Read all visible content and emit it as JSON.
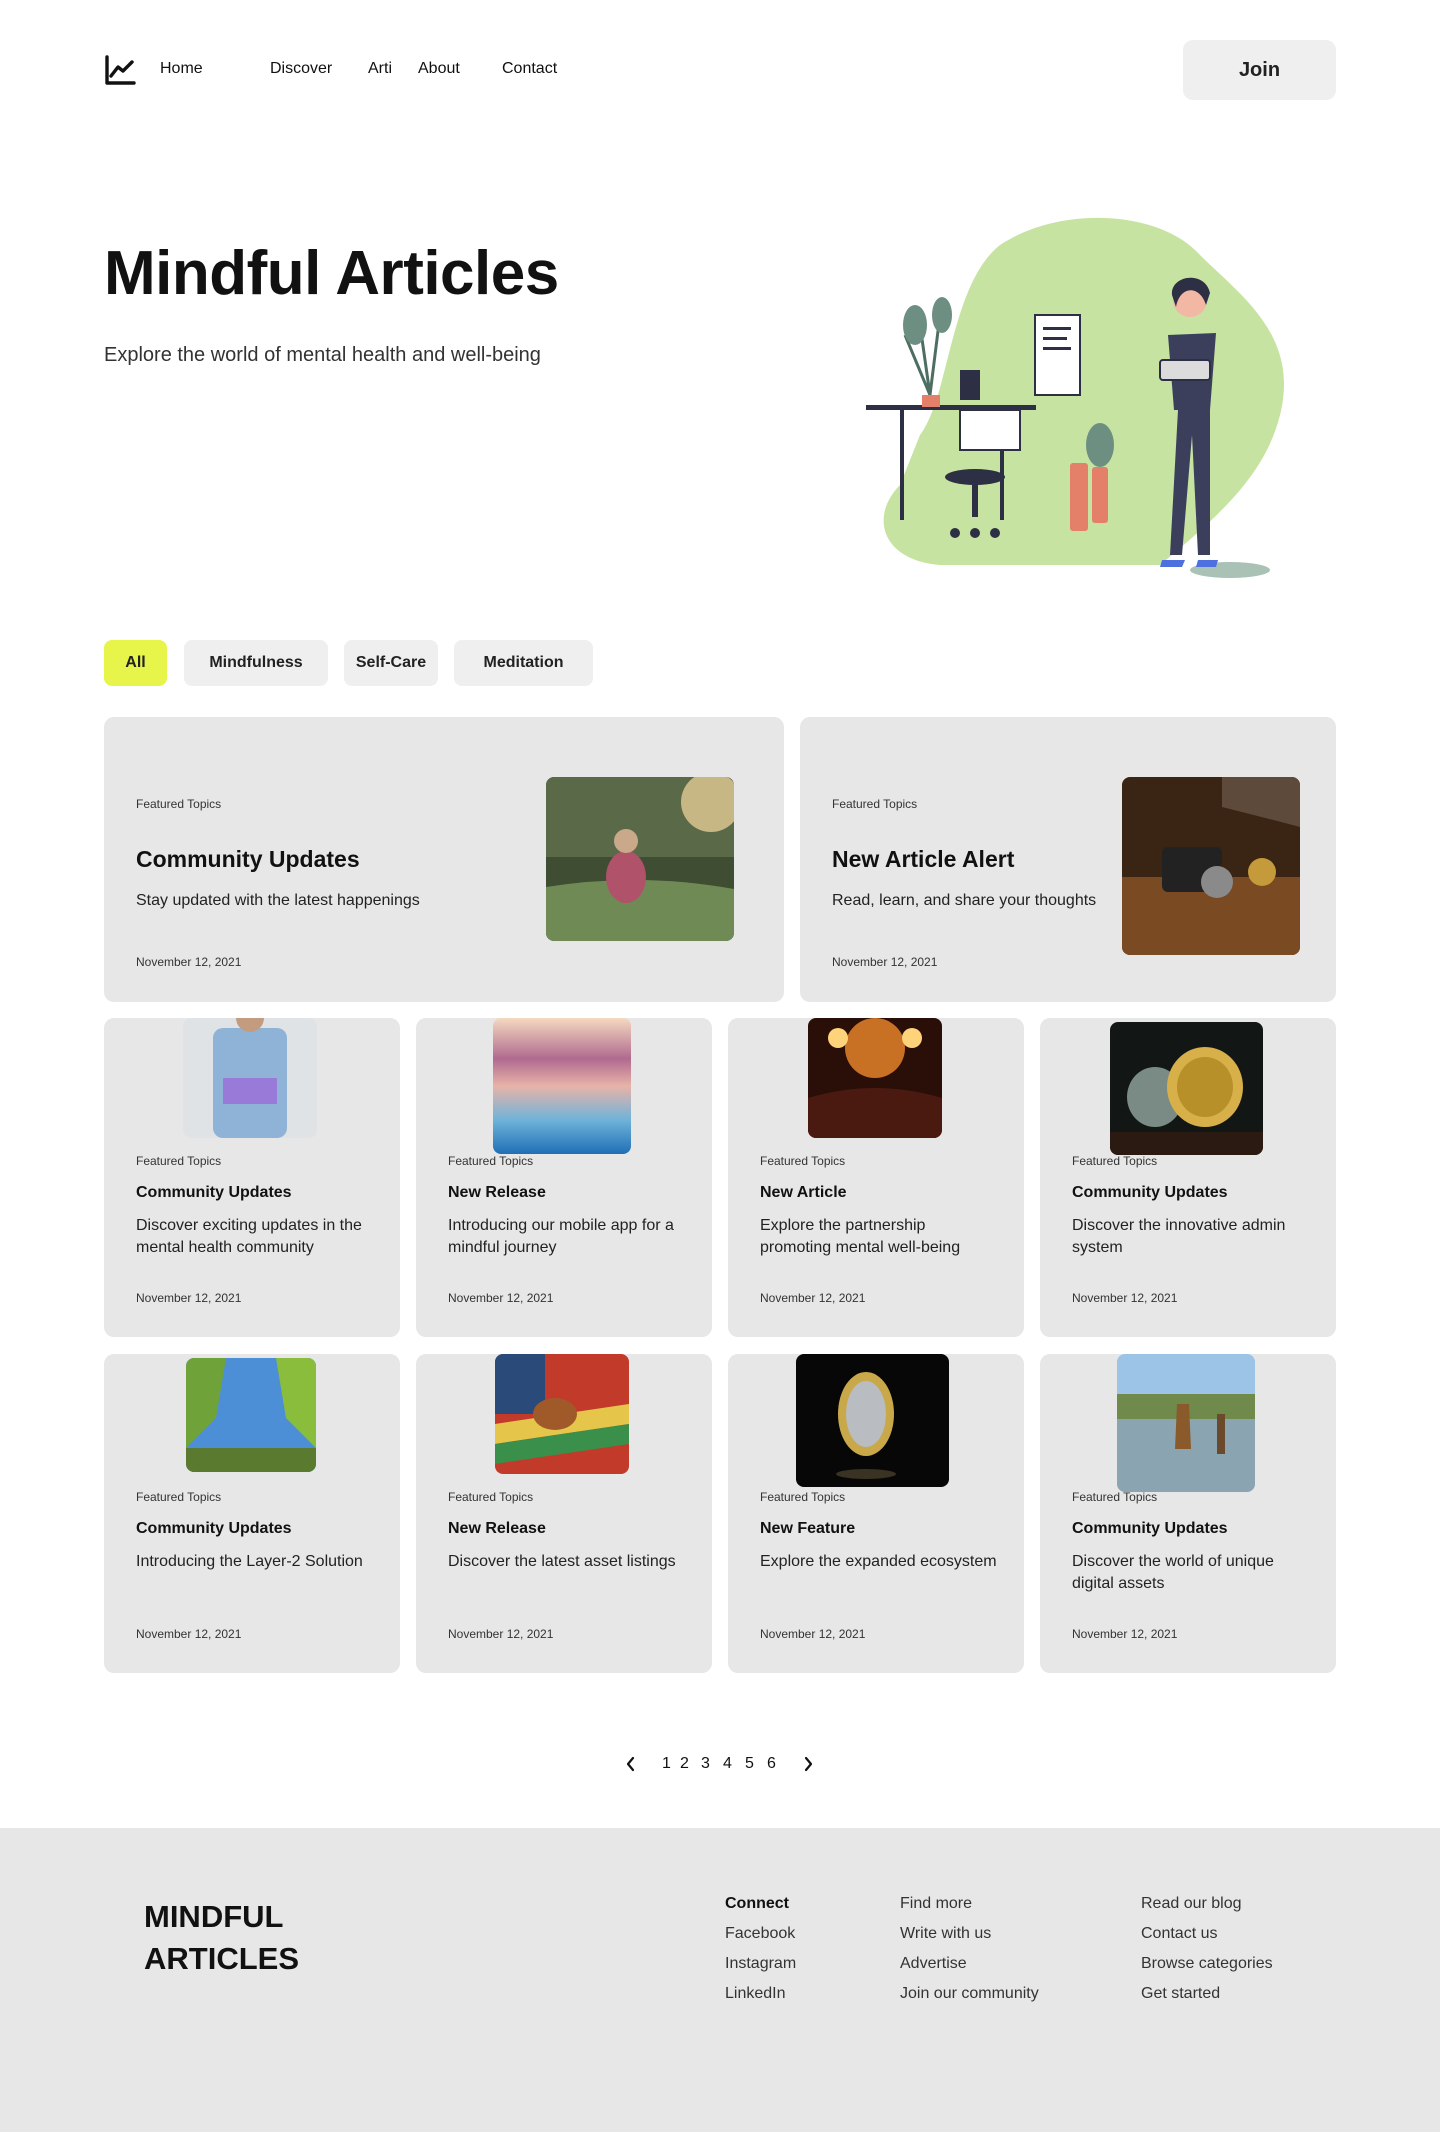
{
  "nav": {
    "links": [
      "Home",
      "Discover",
      "Arti",
      "About",
      "Contact"
    ],
    "join_label": "Join"
  },
  "hero": {
    "title": "Mindful Articles",
    "subtitle": "Explore the world of mental health and well-being"
  },
  "filters": [
    {
      "label": "All",
      "active": true
    },
    {
      "label": "Mindfulness",
      "active": false
    },
    {
      "label": "Self-Care",
      "active": false
    },
    {
      "label": "Meditation",
      "active": false
    }
  ],
  "featured": [
    {
      "topic": "Featured Topics",
      "title": "Community Updates",
      "description": "Stay updated with the latest happenings",
      "date": "November 12, 2021"
    },
    {
      "topic": "Featured Topics",
      "title": "New Article Alert",
      "description": "Read, learn, and share your thoughts",
      "date": "November 12, 2021"
    }
  ],
  "cards": [
    {
      "topic": "Featured Topics",
      "title": "Community Updates",
      "description": "Discover exciting updates in the mental health community",
      "date": "November 12, 2021"
    },
    {
      "topic": "Featured Topics",
      "title": "New Release",
      "description": "Introducing our mobile app for a mindful journey",
      "date": "November 12, 2021"
    },
    {
      "topic": "Featured Topics",
      "title": "New Article",
      "description": "Explore the partnership promoting mental well-being",
      "date": "November 12, 2021"
    },
    {
      "topic": "Featured Topics",
      "title": "Community Updates",
      "description": "Discover the innovative admin system",
      "date": "November 12, 2021"
    },
    {
      "topic": "Featured Topics",
      "title": "Community Updates",
      "description": "Introducing the Layer-2 Solution",
      "date": "November 12, 2021"
    },
    {
      "topic": "Featured Topics",
      "title": "New Release",
      "description": "Discover the latest asset listings",
      "date": "November 12, 2021"
    },
    {
      "topic": "Featured Topics",
      "title": "New Feature",
      "description": "Explore the expanded ecosystem",
      "date": "November 12, 2021"
    },
    {
      "topic": "Featured Topics",
      "title": "Community Updates",
      "description": "Discover the world of unique digital assets",
      "date": "November 12, 2021"
    }
  ],
  "pagination": {
    "prev_icon": "chevron-left-icon",
    "pages": [
      "1",
      "2",
      "3",
      "4",
      "5",
      "6"
    ],
    "next_icon": "chevron-right-icon"
  },
  "footer": {
    "brand_line1": "MINDFUL",
    "brand_line2": "ARTICLES",
    "col1": {
      "heading": "Connect",
      "links": [
        "Facebook",
        "Instagram",
        "LinkedIn"
      ]
    },
    "col2": {
      "links": [
        "Find more",
        "Write with us",
        "Advertise",
        "Join our community"
      ]
    },
    "col3": {
      "links": [
        "Read our blog",
        "Contact us",
        "Browse categories",
        "Get started"
      ]
    }
  },
  "colors": {
    "accent": "#e7f44a",
    "card_bg": "#e7e7e7",
    "button_bg": "#efefef",
    "illustration_green": "#c6e3a2"
  }
}
